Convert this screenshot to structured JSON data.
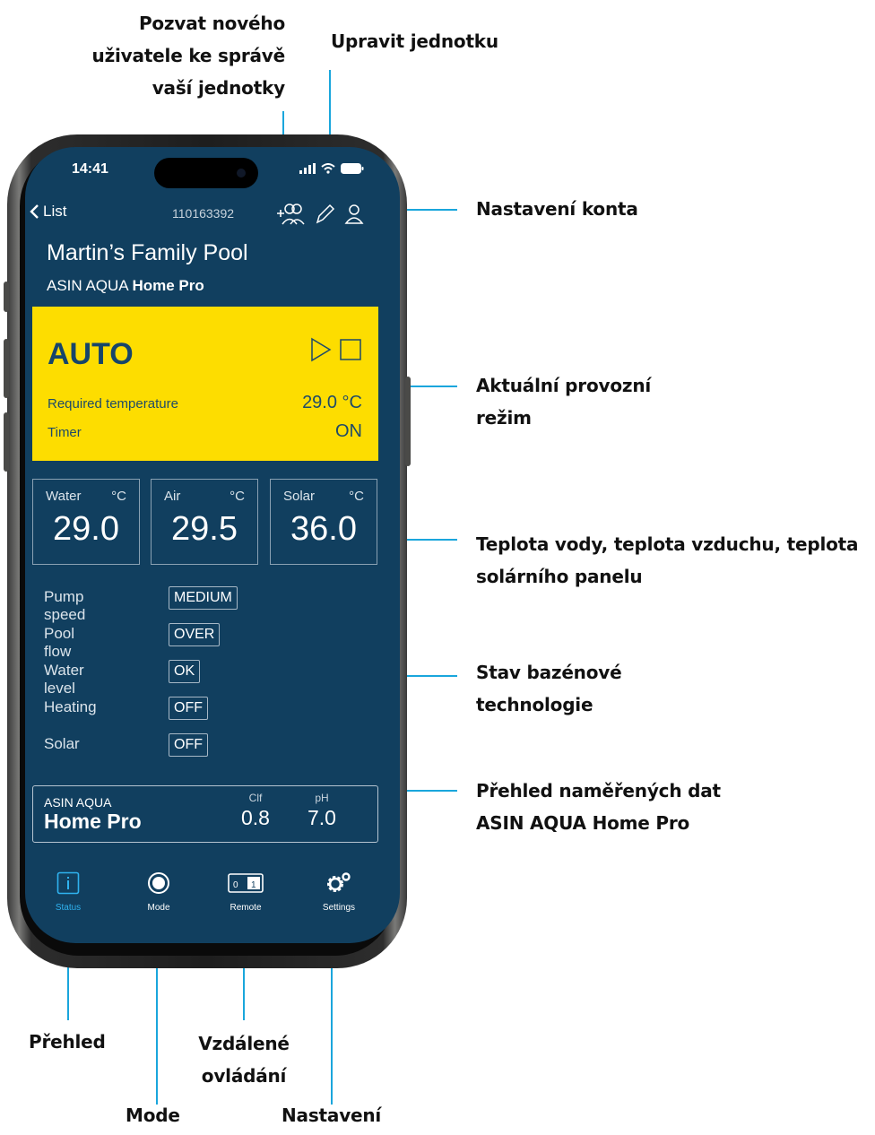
{
  "annotations": {
    "invite": [
      "Pozvat nového",
      "uživatele ke správě",
      "vaší jednotky"
    ],
    "edit_unit": "Upravit jednotku",
    "account_settings": "Nastavení konta",
    "current_mode": [
      "Aktuální provozní",
      "režim"
    ],
    "temperatures": [
      "Teplota vody, teplota vzduchu, teplota",
      "solárního panelu"
    ],
    "technology_status": [
      "Stav bazénové",
      "technologie"
    ],
    "measured_data": [
      "Přehled naměřených dat",
      "ASIN AQUA Home Pro"
    ],
    "overview": "Přehled",
    "remote_control": [
      "Vzdálené",
      "ovládání"
    ],
    "mode": "Mode",
    "settings": "Nastavení"
  },
  "status_bar": {
    "time": "14:41"
  },
  "nav": {
    "back_label": "List",
    "unit_id": "110163392"
  },
  "pool": {
    "name": "Martin’s Family Pool",
    "model_prefix": "ASIN AQUA",
    "model_name": "Home Pro"
  },
  "mode_card": {
    "title": "AUTO",
    "required_temp_label": "Required temperature",
    "required_temp_value": "29.0 °C",
    "timer_label": "Timer",
    "timer_value": "ON",
    "background": "#fddd00"
  },
  "temperatures": [
    {
      "label": "Water",
      "unit": "°C",
      "value": "29.0"
    },
    {
      "label": "Air",
      "unit": "°C",
      "value": "29.5"
    },
    {
      "label": "Solar",
      "unit": "°C",
      "value": "36.0"
    }
  ],
  "status": [
    {
      "label": "Pump speed",
      "value": "MEDIUM"
    },
    {
      "label": "Pool flow",
      "value": "OVER"
    },
    {
      "label": "Water level",
      "value": "OK"
    },
    {
      "label": "Heating",
      "value": "OFF"
    },
    {
      "label": "Solar",
      "value": "OFF"
    }
  ],
  "measurements": {
    "line1": "ASIN AQUA",
    "line2": "Home Pro",
    "clf_label": "Clf",
    "clf_value": "0.8",
    "ph_label": "pH",
    "ph_value": "7.0"
  },
  "tabs": [
    {
      "label": "Status",
      "icon": "info-icon",
      "active": true
    },
    {
      "label": "Mode",
      "icon": "mode-circle-icon",
      "active": false
    },
    {
      "label": "Remote",
      "icon": "remote-switch-icon",
      "active": false
    },
    {
      "label": "Settings",
      "icon": "gear-icon",
      "active": false
    }
  ],
  "remote_switch": {
    "off_label": "0",
    "on_label": "1"
  },
  "colors": {
    "screen_bg": "#113f5f",
    "accent": "#1aa6dc",
    "active_tab": "#2fb2ef",
    "mode_yellow": "#fddd00"
  }
}
